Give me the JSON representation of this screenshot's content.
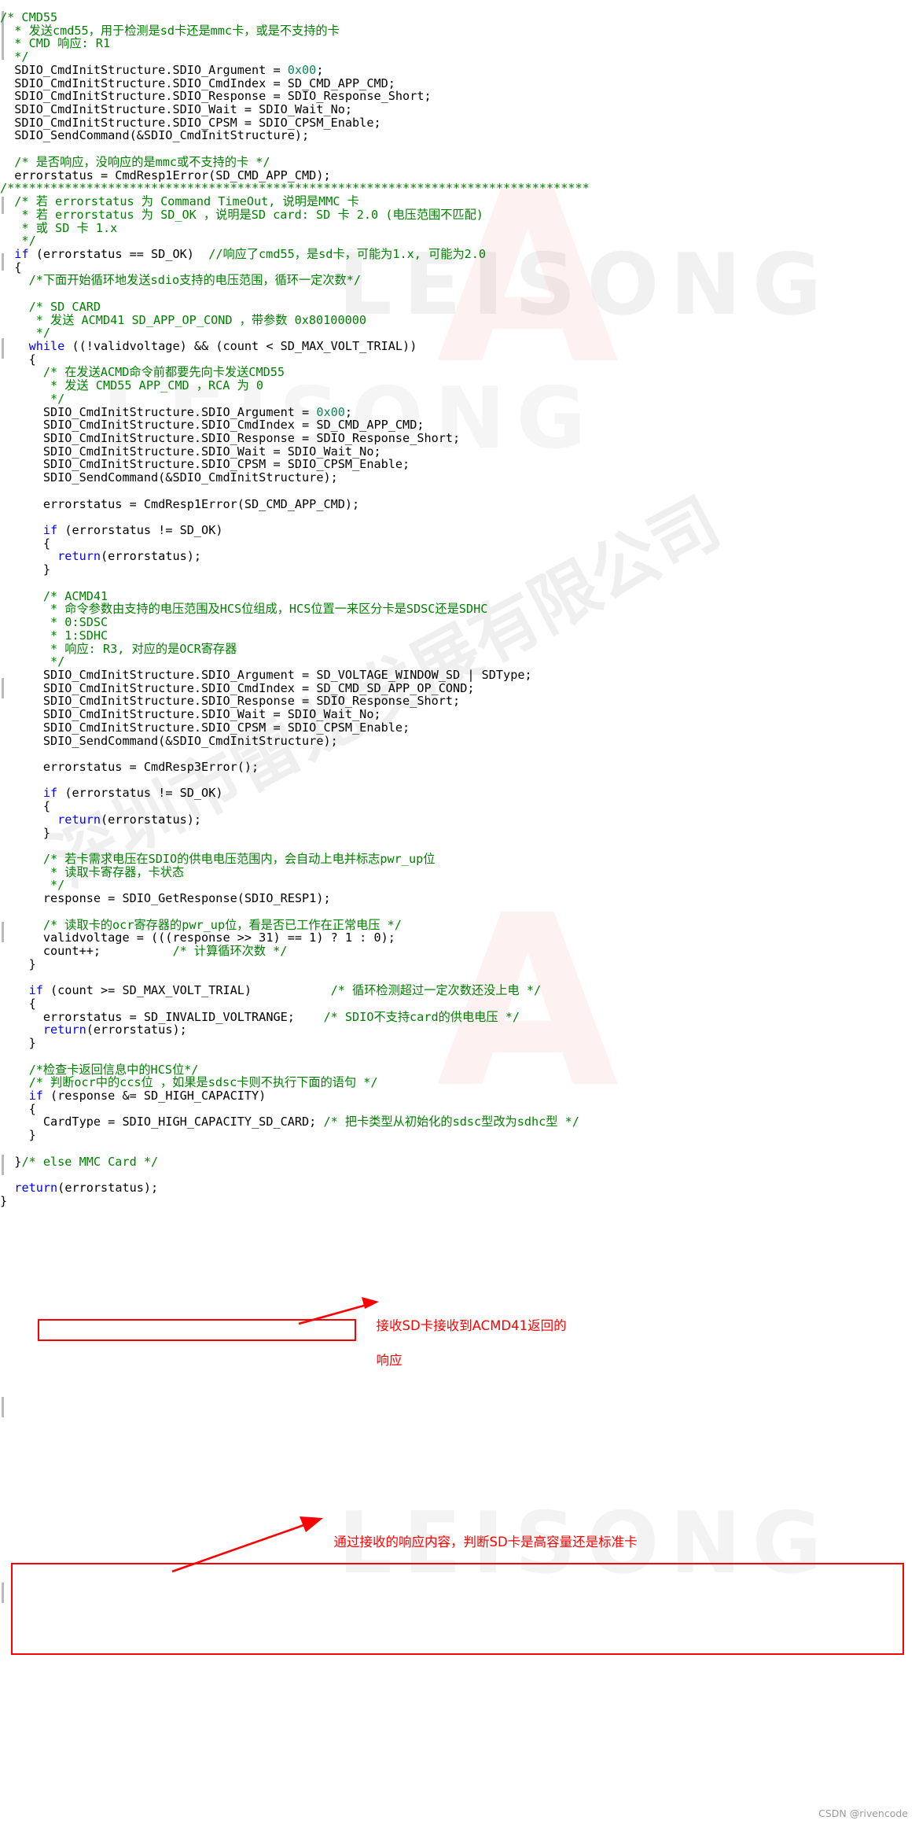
{
  "document": {
    "type": "source-code-screenshot",
    "language": "C",
    "colors": {
      "comment": "#008000",
      "keyword": "#0000ff",
      "number": "#098658",
      "text": "#000000",
      "annotation": "#ff0000",
      "background": "#ffffff"
    }
  },
  "watermarks": {
    "brand_latin": "LEISONG",
    "brand_cn": "深圳市雷龙发展有限公司",
    "letter": "A"
  },
  "footer": {
    "credit": "CSDN @rivencode"
  },
  "annotations": [
    {
      "id": "acmd41-response-note",
      "line1": "接收SD卡接收到ACMD41返回的",
      "line2": "响应"
    },
    {
      "id": "capacity-judgement-note",
      "line1": "通过接收的响应内容，判断SD卡是高容量还是标准卡"
    }
  ],
  "code_lines": [
    {
      "t": "  ",
      "c": "/* CMD55",
      "k": "comment"
    },
    {
      "t": "  ",
      "c": "  * 发送cmd55，用于检测是sd卡还是mmc卡，或是不支持的卡",
      "k": "comment"
    },
    {
      "t": "  ",
      "c": "  * CMD 响应: R1",
      "k": "comment"
    },
    {
      "t": "  ",
      "c": "  */",
      "k": "comment"
    },
    {
      "t": "plain",
      "c": "  SDIO_CmdInitStructure.SDIO_Argument = 0x00;"
    },
    {
      "t": "plain",
      "c": "  SDIO_CmdInitStructure.SDIO_CmdIndex = SD_CMD_APP_CMD;"
    },
    {
      "t": "plain",
      "c": "  SDIO_CmdInitStructure.SDIO_Response = SDIO_Response_Short;"
    },
    {
      "t": "plain",
      "c": "  SDIO_CmdInitStructure.SDIO_Wait = SDIO_Wait_No;"
    },
    {
      "t": "plain",
      "c": "  SDIO_CmdInitStructure.SDIO_CPSM = SDIO_CPSM_Enable;"
    },
    {
      "t": "plain",
      "c": "  SDIO_SendCommand(&SDIO_CmdInitStructure);"
    },
    {
      "t": "blank",
      "c": ""
    },
    {
      "t": "cmt",
      "c": "  /* 是否响应，没响应的是mmc或不支持的卡 */"
    },
    {
      "t": "plain",
      "c": "  errorstatus = CmdResp1Error(SD_CMD_APP_CMD);"
    },
    {
      "t": "cmt",
      "c": "/*********************************************************************************"
    },
    {
      "t": "cmt",
      "c": "  /* 若 errorstatus 为 Command TimeOut, 说明是MMC 卡"
    },
    {
      "t": "cmt",
      "c": "   * 若 errorstatus 为 SD_OK ，说明是SD card: SD 卡 2.0 (电压范围不匹配)"
    },
    {
      "t": "cmt",
      "c": "   * 或 SD 卡 1.x"
    },
    {
      "t": "cmt",
      "c": "   */"
    },
    {
      "t": "plain",
      "c": "  if (errorstatus == SD_OK)  //响应了cmd55，是sd卡，可能为1.x, 可能为2.0"
    },
    {
      "t": "plain",
      "c": "  {"
    },
    {
      "t": "cmt",
      "c": "    /*下面开始循环地发送sdio支持的电压范围，循环一定次数*/"
    },
    {
      "t": "blank",
      "c": ""
    },
    {
      "t": "cmt",
      "c": "    /* SD CARD"
    },
    {
      "t": "cmt",
      "c": "     * 发送 ACMD41 SD_APP_OP_COND ，带参数 0x80100000"
    },
    {
      "t": "cmt",
      "c": "     */"
    },
    {
      "t": "plain",
      "c": "    while ((!validvoltage) && (count < SD_MAX_VOLT_TRIAL))"
    },
    {
      "t": "plain",
      "c": "    {"
    },
    {
      "t": "cmt",
      "c": "      /* 在发送ACMD命令前都要先向卡发送CMD55"
    },
    {
      "t": "cmt",
      "c": "       * 发送 CMD55 APP_CMD ，RCA 为 0"
    },
    {
      "t": "cmt",
      "c": "       */"
    },
    {
      "t": "plain",
      "c": "      SDIO_CmdInitStructure.SDIO_Argument = 0x00;"
    },
    {
      "t": "plain",
      "c": "      SDIO_CmdInitStructure.SDIO_CmdIndex = SD_CMD_APP_CMD;"
    },
    {
      "t": "plain",
      "c": "      SDIO_CmdInitStructure.SDIO_Response = SDIO_Response_Short;"
    },
    {
      "t": "plain",
      "c": "      SDIO_CmdInitStructure.SDIO_Wait = SDIO_Wait_No;"
    },
    {
      "t": "plain",
      "c": "      SDIO_CmdInitStructure.SDIO_CPSM = SDIO_CPSM_Enable;"
    },
    {
      "t": "plain",
      "c": "      SDIO_SendCommand(&SDIO_CmdInitStructure);"
    },
    {
      "t": "blank",
      "c": ""
    },
    {
      "t": "plain",
      "c": "      errorstatus = CmdResp1Error(SD_CMD_APP_CMD);"
    },
    {
      "t": "blank",
      "c": ""
    },
    {
      "t": "plain",
      "c": "      if (errorstatus != SD_OK)"
    },
    {
      "t": "plain",
      "c": "      {"
    },
    {
      "t": "plain",
      "c": "        return(errorstatus);"
    },
    {
      "t": "plain",
      "c": "      }"
    },
    {
      "t": "blank",
      "c": ""
    },
    {
      "t": "cmt",
      "c": "      /* ACMD41"
    },
    {
      "t": "cmt",
      "c": "       * 命令参数由支持的电压范围及HCS位组成，HCS位置一来区分卡是SDSC还是SDHC"
    },
    {
      "t": "cmt",
      "c": "       * 0:SDSC"
    },
    {
      "t": "cmt",
      "c": "       * 1:SDHC"
    },
    {
      "t": "cmt",
      "c": "       * 响应: R3, 对应的是OCR寄存器"
    },
    {
      "t": "cmt",
      "c": "       */"
    },
    {
      "t": "plain",
      "c": "      SDIO_CmdInitStructure.SDIO_Argument = SD_VOLTAGE_WINDOW_SD | SDType;"
    },
    {
      "t": "plain",
      "c": "      SDIO_CmdInitStructure.SDIO_CmdIndex = SD_CMD_SD_APP_OP_COND;"
    },
    {
      "t": "plain",
      "c": "      SDIO_CmdInitStructure.SDIO_Response = SDIO_Response_Short;"
    },
    {
      "t": "plain",
      "c": "      SDIO_CmdInitStructure.SDIO_Wait = SDIO_Wait_No;"
    },
    {
      "t": "plain",
      "c": "      SDIO_CmdInitStructure.SDIO_CPSM = SDIO_CPSM_Enable;"
    },
    {
      "t": "plain",
      "c": "      SDIO_SendCommand(&SDIO_CmdInitStructure);"
    },
    {
      "t": "blank",
      "c": ""
    },
    {
      "t": "plain",
      "c": "      errorstatus = CmdResp3Error();"
    },
    {
      "t": "blank",
      "c": ""
    },
    {
      "t": "plain",
      "c": "      if (errorstatus != SD_OK)"
    },
    {
      "t": "plain",
      "c": "      {"
    },
    {
      "t": "plain",
      "c": "        return(errorstatus);"
    },
    {
      "t": "plain",
      "c": "      }"
    },
    {
      "t": "blank",
      "c": ""
    },
    {
      "t": "cmt",
      "c": "      /* 若卡需求电压在SDIO的供电电压范围内，会自动上电并标志pwr_up位"
    },
    {
      "t": "cmt",
      "c": "       * 读取卡寄存器，卡状态"
    },
    {
      "t": "cmt",
      "c": "       */"
    },
    {
      "t": "plain",
      "c": "      response = SDIO_GetResponse(SDIO_RESP1);"
    },
    {
      "t": "blank",
      "c": ""
    },
    {
      "t": "cmt",
      "c": "      /* 读取卡的ocr寄存器的pwr_up位，看是否已工作在正常电压 */"
    },
    {
      "t": "plain",
      "c": "      validvoltage = (((response >> 31) == 1) ? 1 : 0);"
    },
    {
      "t": "plain",
      "c": "      count++;          /* 计算循环次数 */"
    },
    {
      "t": "plain",
      "c": "    }"
    },
    {
      "t": "blank",
      "c": ""
    },
    {
      "t": "plain",
      "c": "    if (count >= SD_MAX_VOLT_TRIAL)           /* 循环检测超过一定次数还没上电 */"
    },
    {
      "t": "plain",
      "c": "    {"
    },
    {
      "t": "plain",
      "c": "      errorstatus = SD_INVALID_VOLTRANGE;    /* SDIO不支持card的供电电压 */"
    },
    {
      "t": "plain",
      "c": "      return(errorstatus);"
    },
    {
      "t": "plain",
      "c": "    }"
    },
    {
      "t": "blank",
      "c": ""
    },
    {
      "t": "cmt",
      "c": "    /*检查卡返回信息中的HCS位*/"
    },
    {
      "t": "cmt",
      "c": "    /* 判断ocr中的ccs位 ，如果是sdsc卡则不执行下面的语句 */"
    },
    {
      "t": "plain",
      "c": "    if (response &= SD_HIGH_CAPACITY)"
    },
    {
      "t": "plain",
      "c": "    {"
    },
    {
      "t": "plain",
      "c": "      CardType = SDIO_HIGH_CAPACITY_SD_CARD; /* 把卡类型从初始化的sdsc型改为sdhc型 */"
    },
    {
      "t": "plain",
      "c": "    }"
    },
    {
      "t": "blank",
      "c": ""
    },
    {
      "t": "plain",
      "c": "  }/* else MMC Card */"
    },
    {
      "t": "blank",
      "c": ""
    },
    {
      "t": "plain",
      "c": "  return(errorstatus);"
    },
    {
      "t": "plain",
      "c": "}"
    }
  ]
}
